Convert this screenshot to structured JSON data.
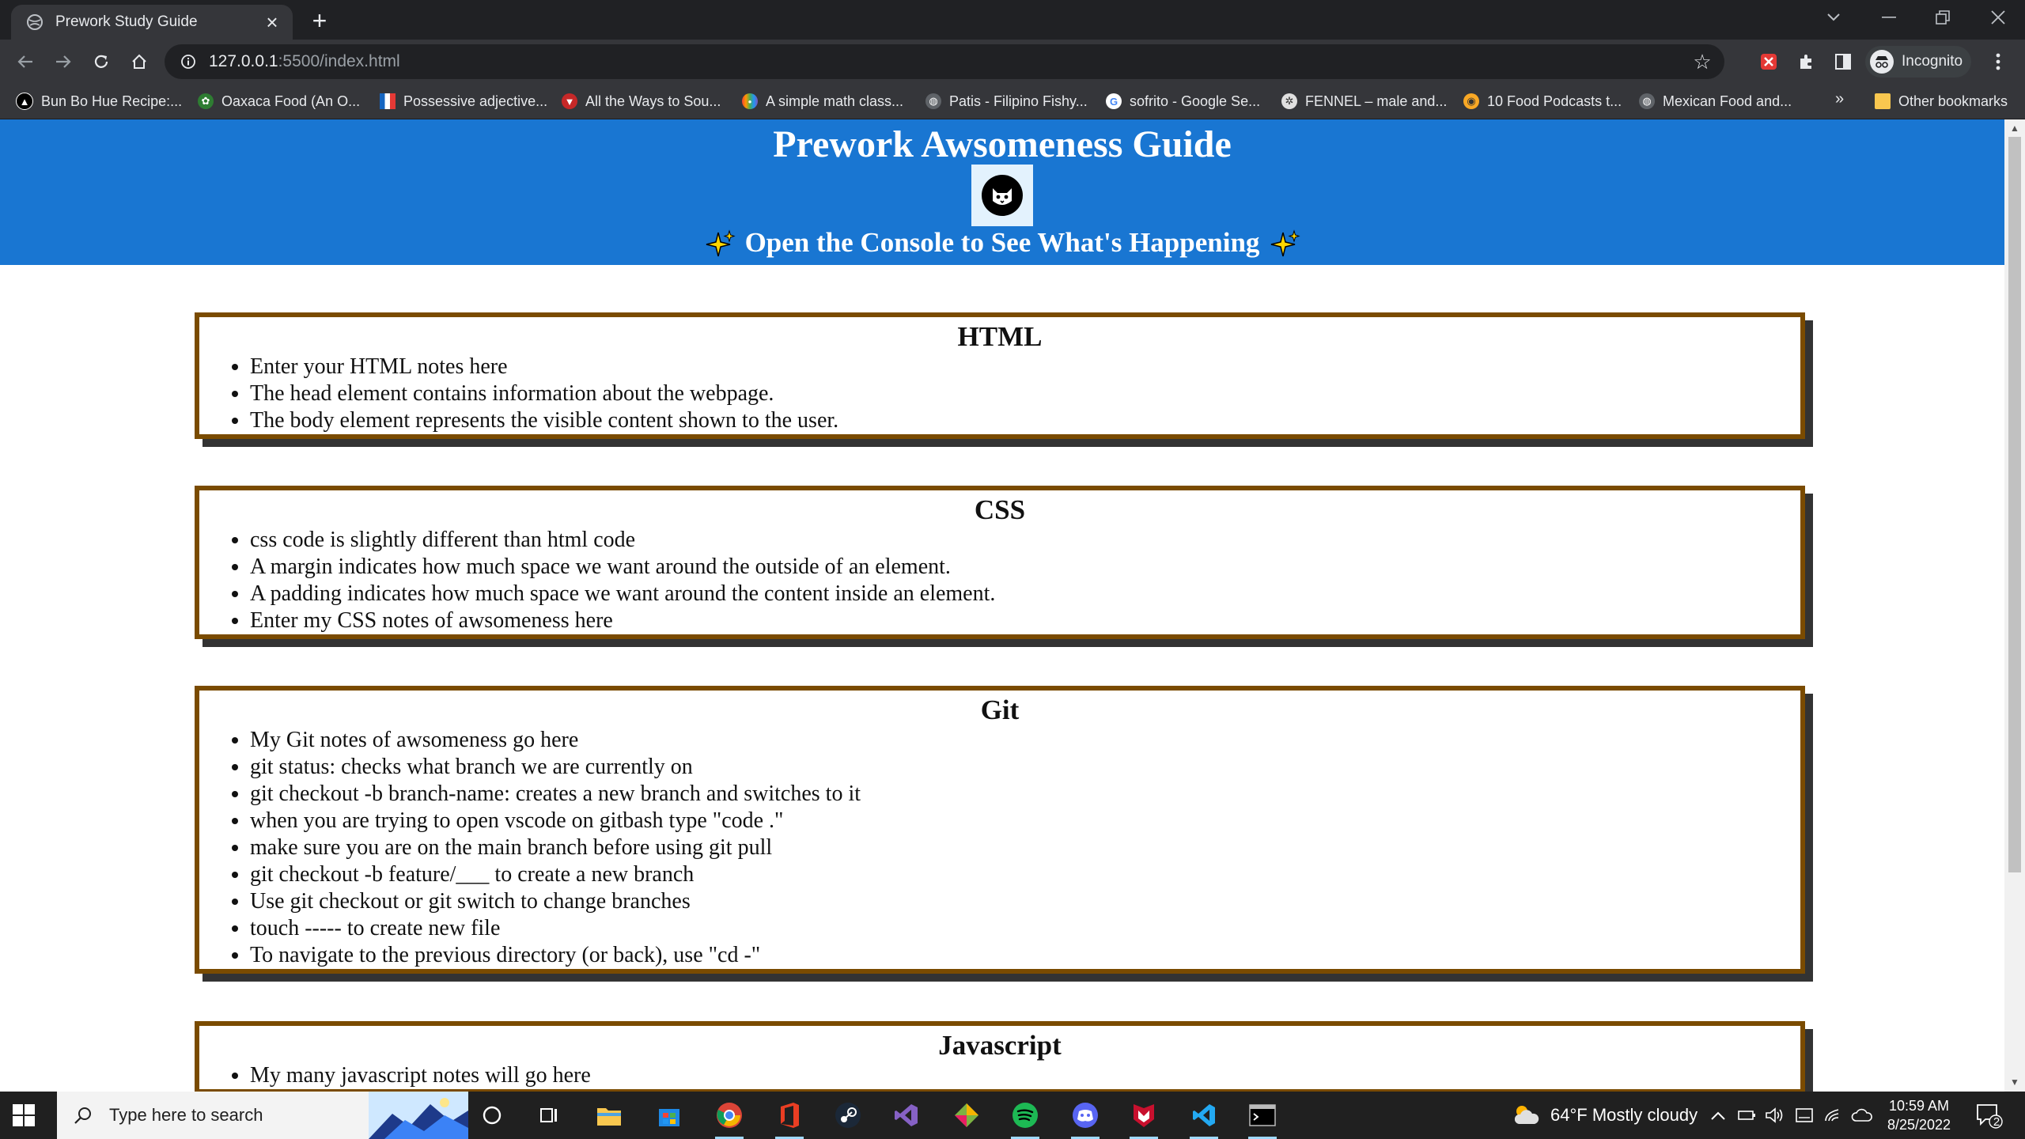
{
  "browser": {
    "tab_title": "Prework Study Guide",
    "url_host": "127.0.0.1",
    "url_rest": ":5500/index.html",
    "profile_label": "Incognito",
    "bookmarks": [
      {
        "label": "Bun Bo Hue Recipe:...",
        "color": "#ffffff"
      },
      {
        "label": "Oaxaca Food (An O...",
        "color": "#4caf50"
      },
      {
        "label": "Possessive adjective...",
        "color": "#1565c0"
      },
      {
        "label": "All the Ways to Sou...",
        "color": "#c62828"
      },
      {
        "label": "A simple math class...",
        "color": "#7e57c2"
      },
      {
        "label": "Patis - Filipino Fishy...",
        "color": "#9e9e9e"
      },
      {
        "label": "sofrito - Google Se...",
        "color": "#4285f4"
      },
      {
        "label": "FENNEL – male and...",
        "color": "#9e9e9e"
      },
      {
        "label": "10 Food Podcasts t...",
        "color": "#f9a825"
      },
      {
        "label": "Mexican Food and...",
        "color": "#9e9e9e"
      }
    ],
    "more_bookmarks": "»",
    "other_bookmarks": "Other bookmarks"
  },
  "page": {
    "title": "Prework Awsomeness Guide",
    "subtitle": "Open the Console to See What's Happening",
    "sections": [
      {
        "heading": "HTML",
        "items": [
          "Enter your HTML notes here",
          "The head element contains information about the webpage.",
          "The body element represents the visible content shown to the user."
        ]
      },
      {
        "heading": "CSS",
        "items": [
          "css code is slightly different than html code",
          "A margin indicates how much space we want around the outside of an element.",
          "A padding indicates how much space we want around the content inside an element.",
          "Enter my CSS notes of awsomeness here"
        ]
      },
      {
        "heading": "Git",
        "items": [
          "My Git notes of awsomeness go here",
          "git status: checks what branch we are currently on",
          "git checkout -b branch-name: creates a new branch and switches to it",
          "when you are trying to open vscode on gitbash type \"code .\"",
          "make sure you are on the main branch before using git pull",
          "git checkout -b feature/___ to create a new branch",
          "Use git checkout or git switch to change branches",
          "touch ----- to create new file",
          "To navigate to the previous directory (or back), use \"cd -\""
        ]
      },
      {
        "heading": "Javascript",
        "items": [
          "My many javascript notes will go here"
        ]
      }
    ],
    "colors": {
      "header_bg": "#1976d2",
      "card_border": "#7a4b00",
      "card_shadow": "#333333"
    }
  },
  "taskbar": {
    "search_placeholder": "Type here to search",
    "weather": "64°F  Mostly cloudy",
    "time": "10:59 AM",
    "date": "8/25/2022",
    "notification_count": "2"
  }
}
